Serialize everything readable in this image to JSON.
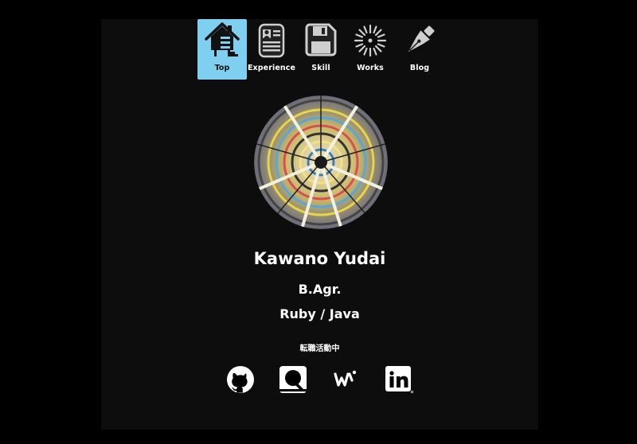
{
  "nav": {
    "items": [
      {
        "label": "Top",
        "icon": "house-icon",
        "active": true
      },
      {
        "label": "Experience",
        "icon": "resume-icon",
        "active": false
      },
      {
        "label": "Skill",
        "icon": "floppy-disk-icon",
        "active": false
      },
      {
        "label": "Works",
        "icon": "firework-icon",
        "active": false
      },
      {
        "label": "Blog",
        "icon": "fountain-pen-icon",
        "active": false
      }
    ],
    "active_color": "#7fcff0"
  },
  "profile": {
    "name": "Kawano Yudai",
    "degree": "B.Agr.",
    "languages": "Ruby / Java",
    "status": "転職活動中"
  },
  "social": [
    {
      "icon": "github-icon"
    },
    {
      "icon": "qiita-icon"
    },
    {
      "icon": "wantedly-icon"
    },
    {
      "icon": "linkedin-icon"
    }
  ],
  "colors": {
    "page_background": "#000000",
    "panel_background": "#0d0d0d",
    "text": "#ffffff"
  }
}
